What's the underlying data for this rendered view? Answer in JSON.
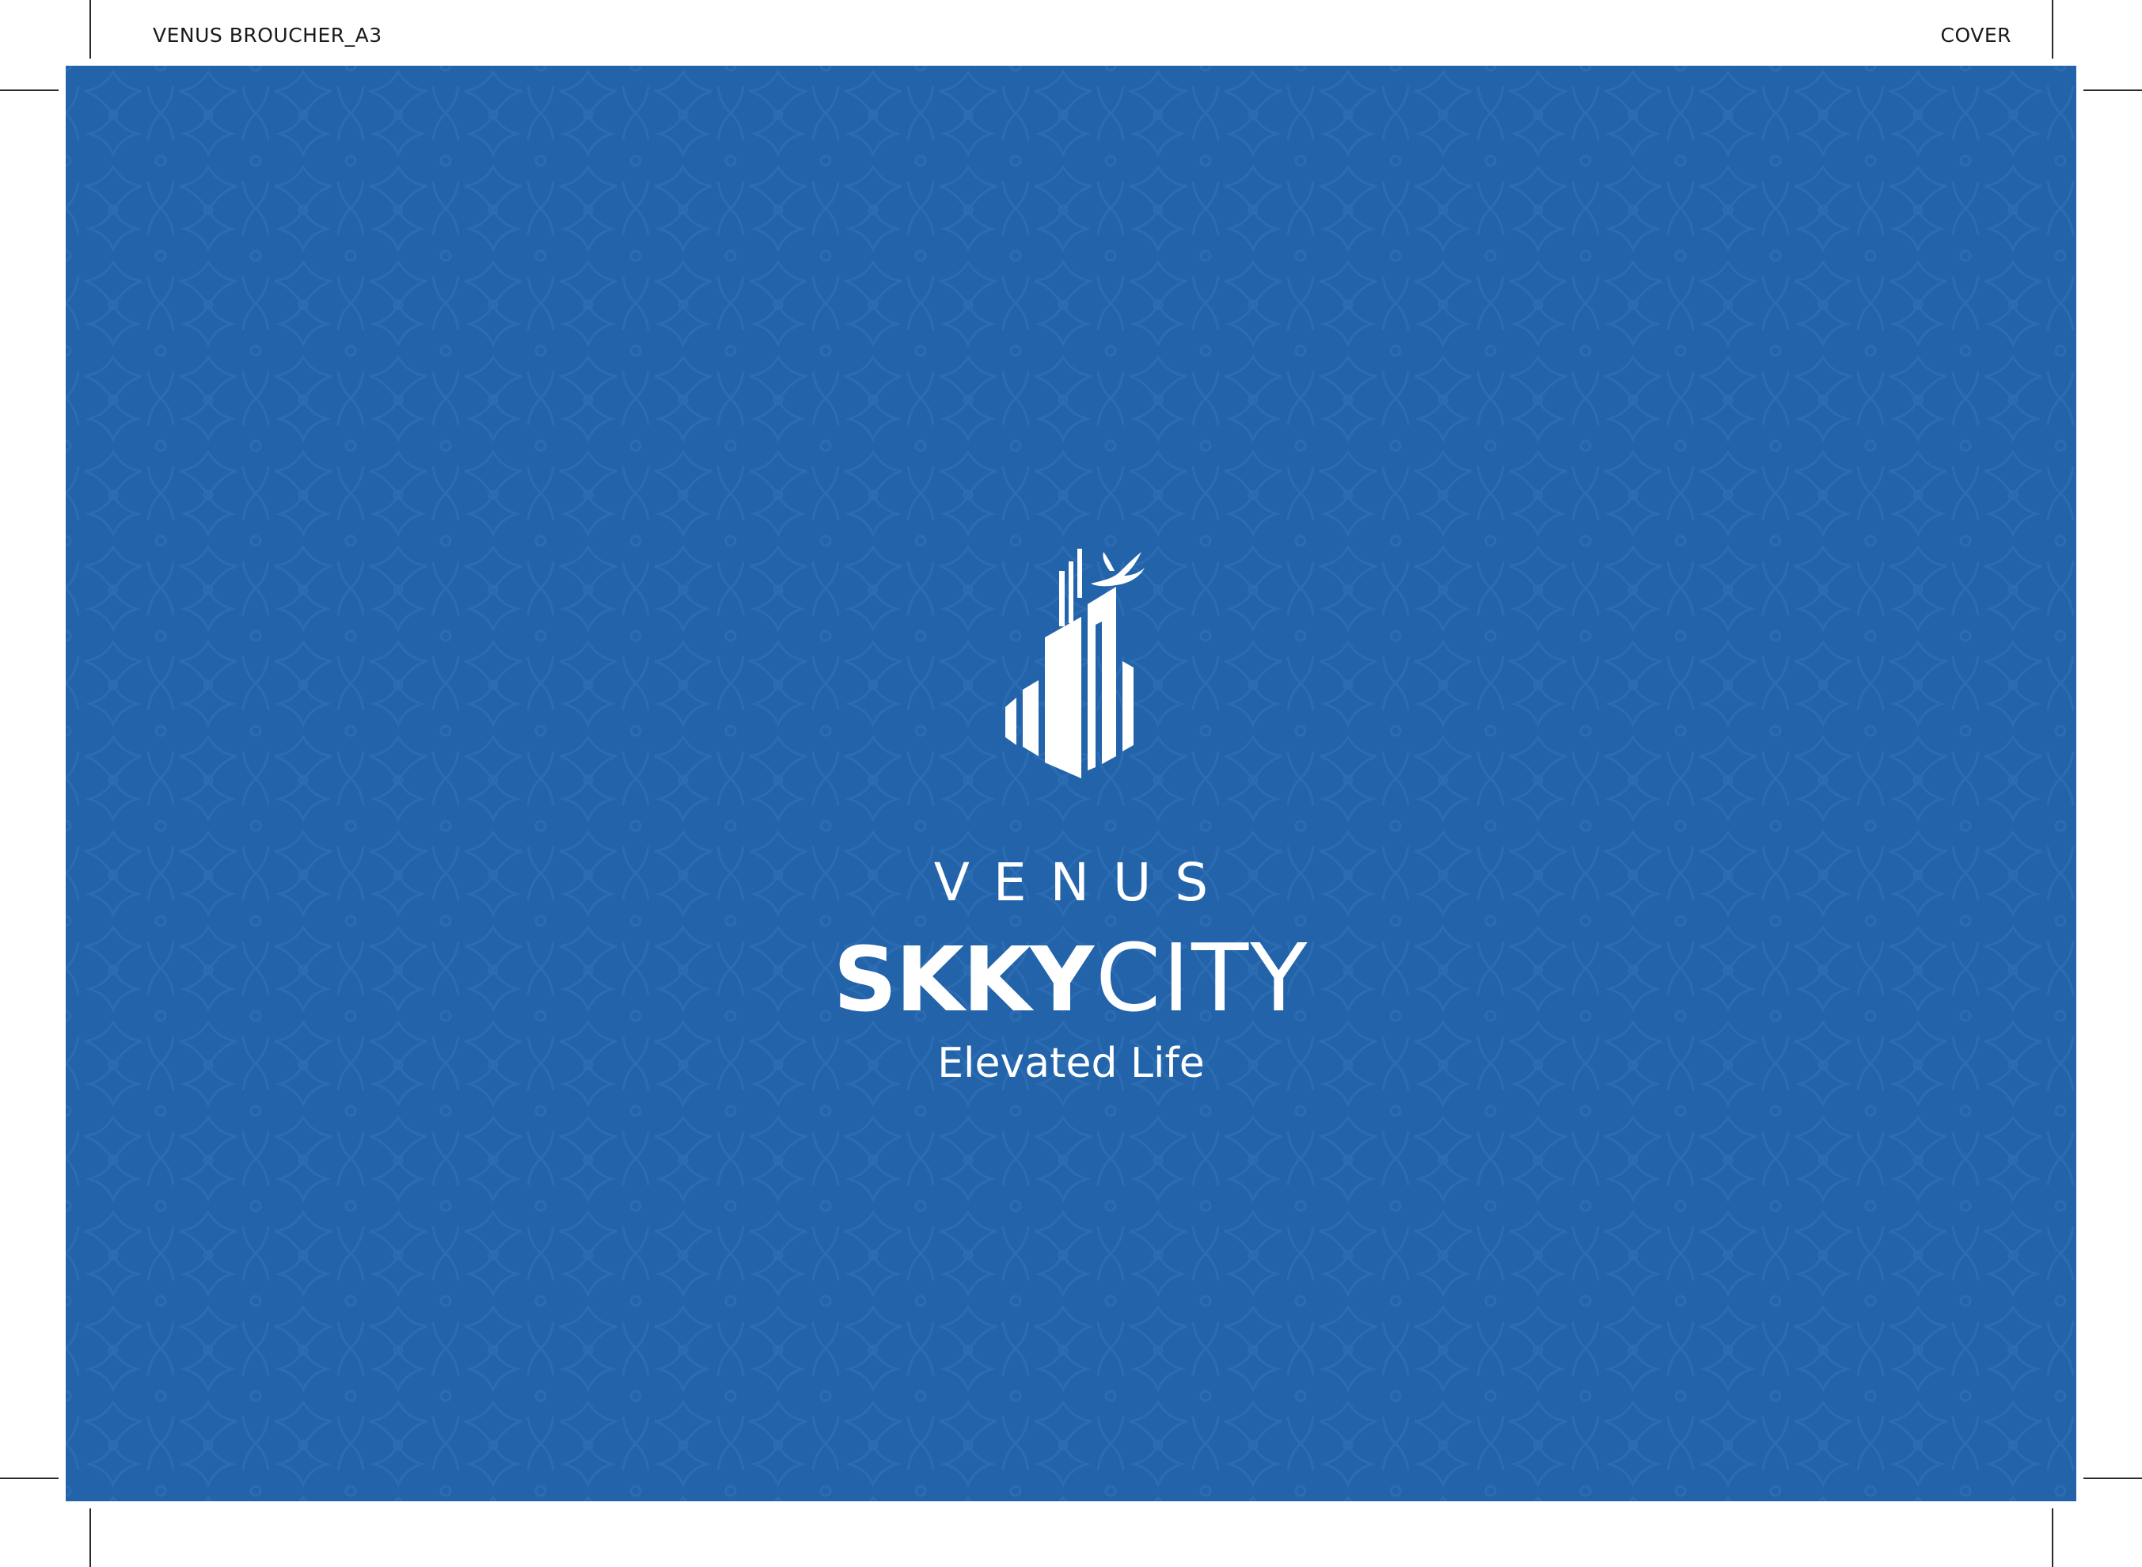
{
  "header": {
    "left_slug": "VENUS BROUCHER_A3",
    "right_slug": "COVER"
  },
  "cover": {
    "background_color": "#2263a9",
    "pattern_color": "#2a6bb1",
    "logo": {
      "icon": "skyscraper-with-bird-icon",
      "brand_top": "VENUS",
      "brand_main_bold": "SKKY",
      "brand_main_light": "CITY",
      "tagline": "Elevated Life"
    }
  }
}
